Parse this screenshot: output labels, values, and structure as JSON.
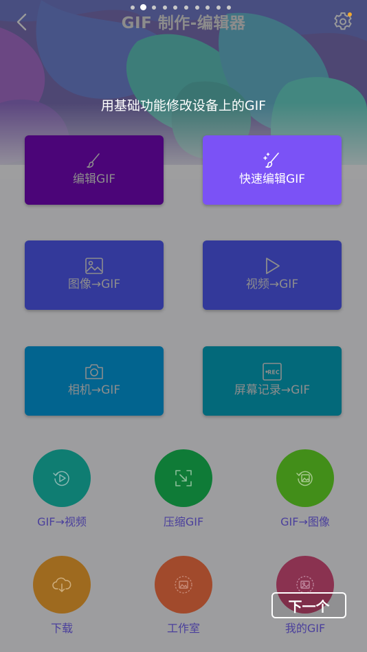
{
  "header": {
    "title": "GIF 制作-编辑器",
    "back_icon": "chevron-left-icon",
    "settings_icon": "gear-icon",
    "settings_badge_color": "#f0a830"
  },
  "onboarding": {
    "page_count": 10,
    "active_page": 2,
    "subtitle": "用基础功能修改设备上的GIF",
    "next_label": "下一个"
  },
  "cards": [
    {
      "label": "编辑GIF",
      "icon": "brush-icon",
      "color": "#4b0578",
      "highlighted": false
    },
    {
      "label": "快速编辑GIF",
      "icon": "brush-sparkle-icon",
      "color": "#7b52f6",
      "highlighted": true
    },
    {
      "label": "图像→GIF",
      "icon": "image-icon",
      "color": "#33399a",
      "highlighted": false
    },
    {
      "label": "视频→GIF",
      "icon": "play-icon",
      "color": "#33399a",
      "highlighted": false
    },
    {
      "label": "相机→GIF",
      "icon": "camera-icon",
      "color": "#02648f",
      "highlighted": false
    },
    {
      "label": "屏幕记录→GIF",
      "icon": "rec-icon",
      "color": "#03697a",
      "highlighted": false
    }
  ],
  "circles": [
    {
      "label": "GIF→视频",
      "icon": "replay-video-icon",
      "color": "#0f7d72"
    },
    {
      "label": "压缩GIF",
      "icon": "compress-icon",
      "color": "#0f7b37"
    },
    {
      "label": "GIF→图像",
      "icon": "replay-image-icon",
      "color": "#428e19"
    },
    {
      "label": "下载",
      "icon": "cloud-download-icon",
      "color": "#9e6a1f"
    },
    {
      "label": "工作室",
      "icon": "studio-icon",
      "color": "#a14a2c"
    },
    {
      "label": "我的GIF",
      "icon": "my-gif-icon",
      "color": "#8a3250"
    }
  ]
}
